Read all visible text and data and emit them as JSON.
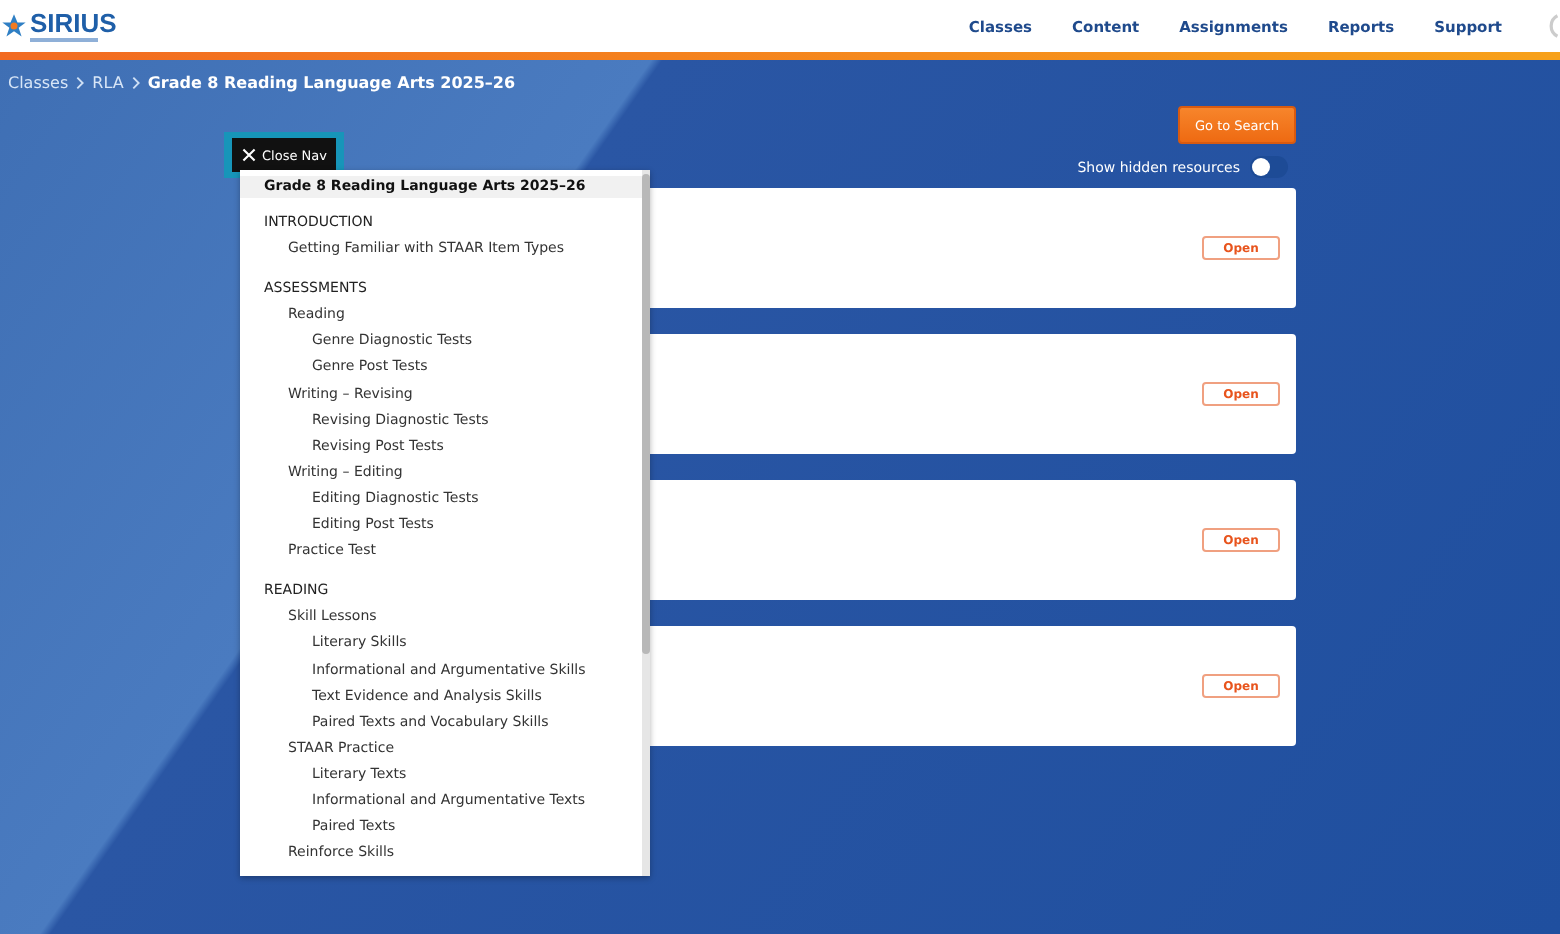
{
  "header": {
    "logo": {
      "name": "SIRIUS"
    },
    "nav": [
      {
        "label": "Classes"
      },
      {
        "label": "Content"
      },
      {
        "label": "Assignments"
      },
      {
        "label": "Reports"
      },
      {
        "label": "Support"
      }
    ]
  },
  "breadcrumb": [
    {
      "label": "Classes"
    },
    {
      "label": "RLA"
    },
    {
      "label": "Grade 8 Reading Language Arts 2025–26"
    }
  ],
  "toolbar": {
    "search_button": "Go to Search",
    "hidden_toggle": {
      "label": "Show hidden resources",
      "on": false
    }
  },
  "cards": [
    {
      "button": "Open"
    },
    {
      "button": "Open"
    },
    {
      "button": "Open"
    },
    {
      "button": "Open"
    }
  ],
  "side_nav": {
    "close_button": "Close Nav",
    "title": "Grade 8 Reading Language Arts 2025–26",
    "sections": [
      {
        "label": "INTRODUCTION",
        "children": [
          {
            "label": "Getting Familiar with STAAR Item Types"
          }
        ]
      },
      {
        "label": "ASSESSMENTS",
        "children": [
          {
            "label": "Reading",
            "children": [
              {
                "label": "Genre Diagnostic Tests"
              },
              {
                "label": "Genre Post Tests"
              }
            ]
          },
          {
            "label": "Writing – Revising",
            "children": [
              {
                "label": "Revising Diagnostic Tests"
              },
              {
                "label": "Revising Post Tests"
              }
            ]
          },
          {
            "label": "Writing – Editing",
            "children": [
              {
                "label": "Editing Diagnostic Tests"
              },
              {
                "label": "Editing Post Tests"
              }
            ]
          },
          {
            "label": "Practice Test"
          }
        ]
      },
      {
        "label": "READING",
        "children": [
          {
            "label": "Skill Lessons",
            "children": [
              {
                "label": "Literary Skills"
              },
              {
                "label": "Informational and Argumentative Skills"
              },
              {
                "label": "Text Evidence and Analysis Skills"
              },
              {
                "label": "Paired Texts and Vocabulary Skills"
              }
            ]
          },
          {
            "label": "STAAR Practice",
            "children": [
              {
                "label": "Literary Texts"
              },
              {
                "label": "Informational and Argumentative Texts"
              },
              {
                "label": "Paired Texts"
              }
            ]
          },
          {
            "label": "Reinforce Skills"
          }
        ]
      }
    ]
  }
}
